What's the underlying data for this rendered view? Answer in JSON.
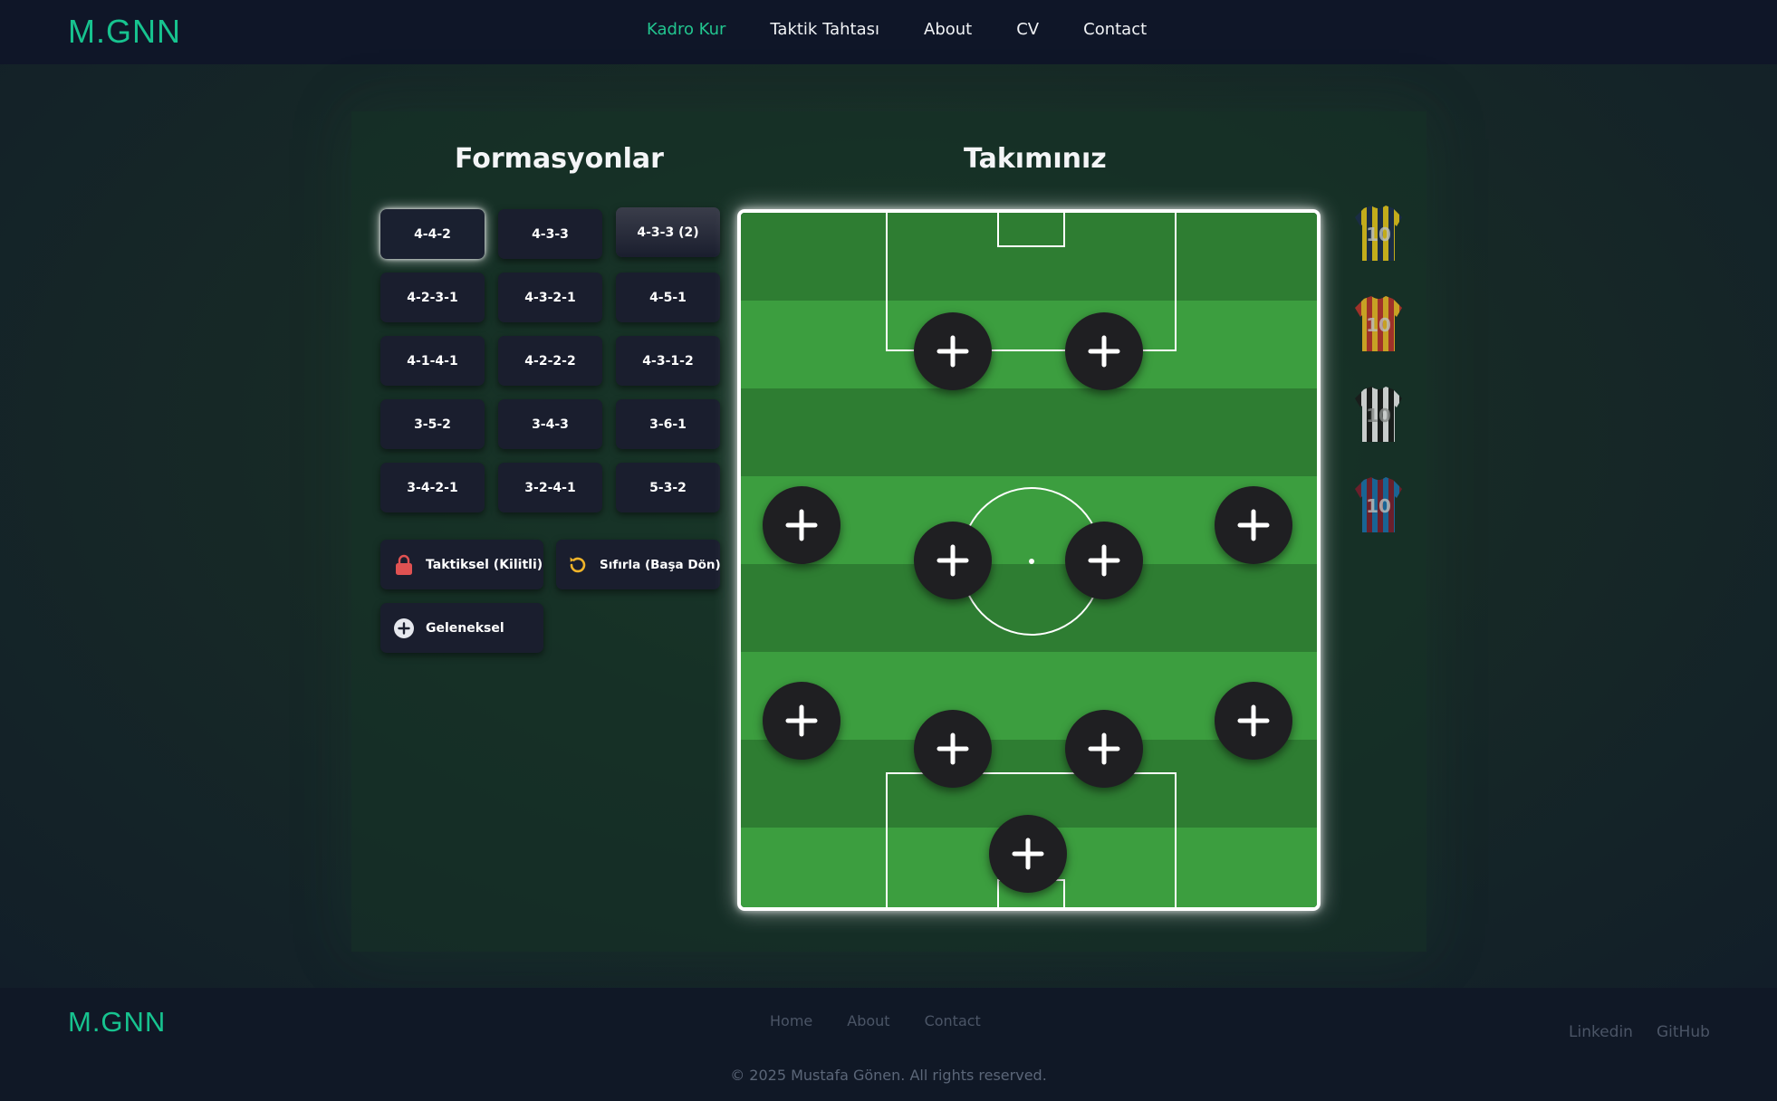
{
  "brand": {
    "logo": "M.GNN",
    "accent": "#17c38f"
  },
  "nav": [
    {
      "label": "Kadro Kur",
      "active": true
    },
    {
      "label": "Taktik Tahtası",
      "active": false
    },
    {
      "label": "About",
      "active": false
    },
    {
      "label": "CV",
      "active": false
    },
    {
      "label": "Contact",
      "active": false
    }
  ],
  "sidebar": {
    "heading": "Formasyonlar",
    "formations": [
      "4-4-2",
      "4-3-3",
      "4-3-3 (2)",
      "4-2-3-1",
      "4-3-2-1",
      "4-5-1",
      "4-1-4-1",
      "4-2-2-2",
      "4-3-1-2",
      "3-5-2",
      "3-4-3",
      "3-6-1",
      "3-4-2-1",
      "3-2-4-1",
      "5-3-2"
    ],
    "selected_formation": "4-4-2",
    "actions": {
      "tactical": "Taktiksel (Kilitli)",
      "reset": "Sıfırla (Başa Dön)",
      "traditional": "Geleneksel"
    }
  },
  "pitch": {
    "heading": "Takımınız",
    "add_slot_icon": "plus-icon",
    "slot_count": 11
  },
  "jerseys": [
    {
      "name": "jersey-yellow-navy",
      "number": "10",
      "colors": [
        "#e2c21a",
        "#1b2c4a"
      ]
    },
    {
      "name": "jersey-red-yellow",
      "number": "10",
      "colors": [
        "#b8322a",
        "#e6b524"
      ]
    },
    {
      "name": "jersey-black-white",
      "number": "10",
      "colors": [
        "#1a1a1a",
        "#f2f2f2"
      ]
    },
    {
      "name": "jersey-blue-maroon",
      "number": "10",
      "colors": [
        "#1a6ea8",
        "#7a1d2c"
      ]
    }
  ],
  "footer": {
    "logo": "M.GNN",
    "links": [
      "Home",
      "About",
      "Contact"
    ],
    "social": [
      "Linkedin",
      "GitHub"
    ],
    "copyright": "© 2025 Mustafa Gönen. All rights reserved."
  },
  "colors": {
    "pitch_light": "#3c9e3f",
    "pitch_dark": "#2e7d32",
    "button_bg": "#1a1e2e",
    "slot_bg": "#1f1f22",
    "lock_red": "#e05252",
    "reset_yellow": "#f0b429"
  }
}
